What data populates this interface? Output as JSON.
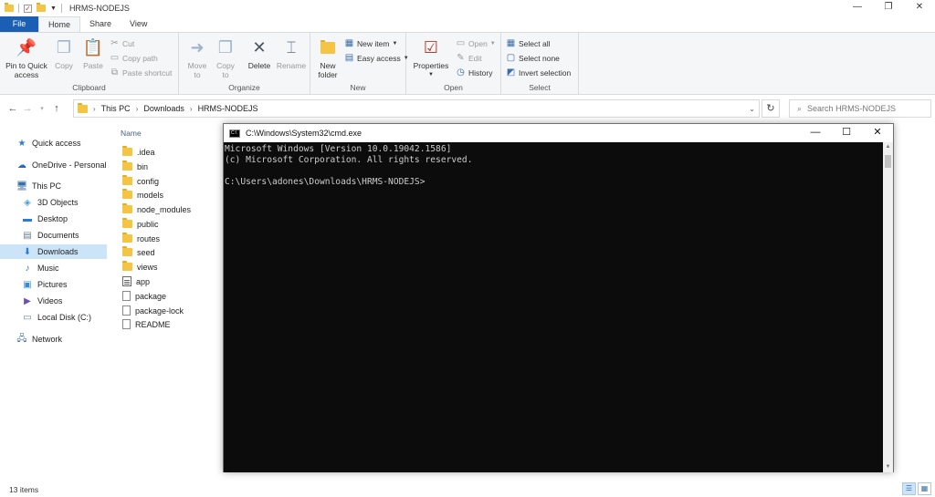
{
  "window": {
    "title": "HRMS-NODEJS",
    "controls": {
      "minimize": "—",
      "maximize": "❐",
      "close": "✕"
    }
  },
  "ribbon_tabs": [
    {
      "label": "File"
    },
    {
      "label": "Home"
    },
    {
      "label": "Share"
    },
    {
      "label": "View"
    }
  ],
  "ribbon": {
    "clipboard": {
      "label": "Clipboard",
      "pin": "Pin to Quick",
      "pin2": "access",
      "copy": "Copy",
      "paste": "Paste",
      "cut": "Cut",
      "copy_path": "Copy path",
      "paste_shortcut": "Paste shortcut"
    },
    "organize": {
      "label": "Organize",
      "move_to": "Move",
      "move_to2": "to",
      "copy_to": "Copy",
      "copy_to2": "to",
      "delete": "Delete",
      "rename": "Rename"
    },
    "new": {
      "label": "New",
      "new_folder": "New",
      "new_folder2": "folder",
      "new_item": "New item",
      "easy_access": "Easy access"
    },
    "open": {
      "label": "Open",
      "properties": "Properties",
      "open": "Open",
      "edit": "Edit",
      "history": "History"
    },
    "select": {
      "label": "Select",
      "select_all": "Select all",
      "select_none": "Select none",
      "invert": "Invert selection"
    }
  },
  "address": {
    "crumbs": [
      "This PC",
      "Downloads",
      "HRMS-NODEJS"
    ],
    "search_placeholder": "Search HRMS-NODEJS"
  },
  "nav_pane": [
    {
      "label": "Quick access",
      "icon": "star-icon"
    },
    {
      "label": "OneDrive - Personal",
      "icon": "cloud-icon"
    },
    {
      "label": "This PC",
      "icon": "computer-icon"
    },
    {
      "label": "3D Objects",
      "icon": "cube-icon"
    },
    {
      "label": "Desktop",
      "icon": "desktop-icon"
    },
    {
      "label": "Documents",
      "icon": "documents-icon"
    },
    {
      "label": "Downloads",
      "icon": "download-icon"
    },
    {
      "label": "Music",
      "icon": "music-icon"
    },
    {
      "label": "Pictures",
      "icon": "pictures-icon"
    },
    {
      "label": "Videos",
      "icon": "videos-icon"
    },
    {
      "label": "Local Disk (C:)",
      "icon": "disk-icon"
    },
    {
      "label": "Network",
      "icon": "network-icon"
    }
  ],
  "file_list": {
    "column_name": "Name",
    "items": [
      {
        "name": ".idea",
        "type": "folder"
      },
      {
        "name": "bin",
        "type": "folder"
      },
      {
        "name": "config",
        "type": "folder"
      },
      {
        "name": "models",
        "type": "folder"
      },
      {
        "name": "node_modules",
        "type": "folder"
      },
      {
        "name": "public",
        "type": "folder"
      },
      {
        "name": "routes",
        "type": "folder"
      },
      {
        "name": "seed",
        "type": "folder"
      },
      {
        "name": "views",
        "type": "folder"
      },
      {
        "name": "app",
        "type": "app"
      },
      {
        "name": "package",
        "type": "file"
      },
      {
        "name": "package-lock",
        "type": "file"
      },
      {
        "name": "README",
        "type": "file"
      }
    ]
  },
  "status": {
    "count": "13 items"
  },
  "cmd": {
    "title": "C:\\Windows\\System32\\cmd.exe",
    "line1": "Microsoft Windows [Version 10.0.19042.1586]",
    "line2": "(c) Microsoft Corporation. All rights reserved.",
    "line3": "",
    "line4": "C:\\Users\\adones\\Downloads\\HRMS-NODEJS>"
  },
  "colors": {
    "file_tab": "#1a5fb4",
    "selected": "#cce4f7",
    "folder": "#f3c542",
    "console_bg": "#0c0c0c",
    "console_text": "#cccccc"
  }
}
